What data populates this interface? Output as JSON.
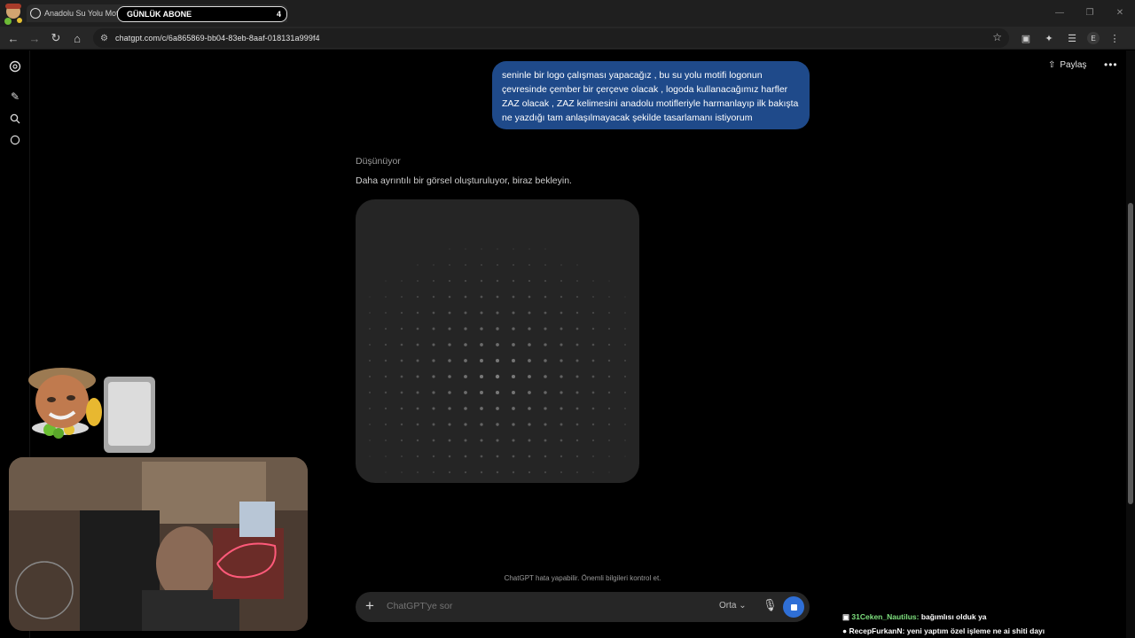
{
  "browser": {
    "tab_title": "Anadolu Su Yolu Motifi",
    "abone_label": "GÜNLÜK ABONE",
    "abone_count": "4",
    "url": "chatgpt.com/c/6a865869-bb04-83eb-8aaf-018131a999f4",
    "avatar_letter": "E"
  },
  "header": {
    "share_label": "Paylaş"
  },
  "conversation": {
    "user_message": "seninle bir logo çalışması yapacağız , bu su yolu motifi logonun çevresinde çember bir çerçeve olacak , logoda kullanacağımız harfler ZAZ olacak , ZAZ kelimesini anadolu motifleriyle harmanlayıp ilk bakışta ne yazdığı tam anlaşılmayacak şekilde tasarlamanı istiyorum",
    "thinking_label": "Düşünüyor",
    "status_text": "Daha ayrıntılı bir görsel oluşturuluyor, biraz bekleyin."
  },
  "composer": {
    "placeholder": "ChatGPT'ye sor",
    "model_label": "Orta",
    "disclaimer": "ChatGPT hata yapabilir. Önemli bilgileri kontrol et."
  },
  "stream_chat": [
    {
      "user": "31Ceken_Nautilus:",
      "message": "bağımlısı olduk ya"
    },
    {
      "user": "RecepFurkanN:",
      "message": "yeni yaptım özel işleme ne ai shiti dayı"
    }
  ],
  "colors": {
    "accent": "#2f6fd6",
    "user_bubble": "#1f4a8a",
    "image_placeholder": "#252525"
  }
}
